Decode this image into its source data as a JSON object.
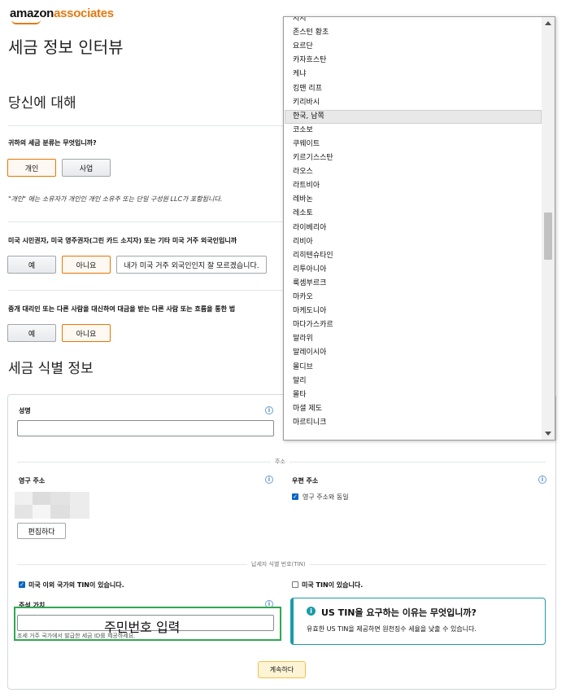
{
  "brand": {
    "part1": "amazon",
    "part2": "associates"
  },
  "page_title": "세금 정보 인터뷰",
  "about_section": {
    "title": "당신에 대해",
    "tax_class_question": "귀하의 세금 분류는 무엇입니까?",
    "tax_class_options": [
      "개인",
      "사업"
    ],
    "tax_class_note": "\"개인\" 에는 소유자가 개인인 개인 소유주 또는 단일 구성원 LLC가 포함됩니다.",
    "us_person_question": "미국 시민권자, 미국 영주권자(그린 카드 소지자) 또는 기타 미국 거주 외국인입니까",
    "us_person_options": [
      "예",
      "아니요",
      "내가 미국 거주 외국인인지 잘 모르겠습니다."
    ],
    "agent_question": "중개 대리인 또는 다른 사람을 대신하여 대금을 받는 다른 사람 또는 흐름을 통한 법",
    "agent_options": [
      "예",
      "아니요"
    ]
  },
  "tax_id_section": {
    "title": "세금 식별 정보",
    "name_label": "성명",
    "address_divider": "주소",
    "permanent_address_label": "영구 주소",
    "mailing_address_label": "우편 주소",
    "same_as_permanent": "영구 주소와 동일",
    "edit_button": "편집하다",
    "tin_divider": "납세자 식별 번호(TIN)",
    "non_us_tin_checkbox": "미국 이외 국가의 TIN이 있습니다.",
    "us_tin_checkbox": "미국 TIN이 있습니다.",
    "foreign_tin_label": "주석 가치",
    "foreign_tin_help": "조세 거주 국가에서 발급한 세금 ID를 제공하세요.",
    "overlay_caption": "주민번호 입력",
    "why_tin_title": "US TIN을 요구하는 이유는 무엇입니까?",
    "why_tin_body": "유효한 US TIN을 제공하면 원천징수 세율을 낮출 수 있습니다.",
    "continue_button": "계속하다"
  },
  "country_dropdown": {
    "items": [
      "저지",
      "존스턴 황초",
      "요르단",
      "카자흐스탄",
      "케냐",
      "킹맨 리프",
      "키리바시",
      "한국, 남쪽",
      "코소보",
      "쿠웨이트",
      "키르기스스탄",
      "라오스",
      "라트비아",
      "레바논",
      "레소토",
      "라이베리아",
      "리비아",
      "리히텐슈타인",
      "리투아니아",
      "룩셈부르크",
      "마카오",
      "마케도니아",
      "마다가스카르",
      "말라위",
      "말레이시아",
      "몰디브",
      "말리",
      "몰타",
      "마셜 제도",
      "마르티니크"
    ],
    "highlighted_index": 7
  }
}
